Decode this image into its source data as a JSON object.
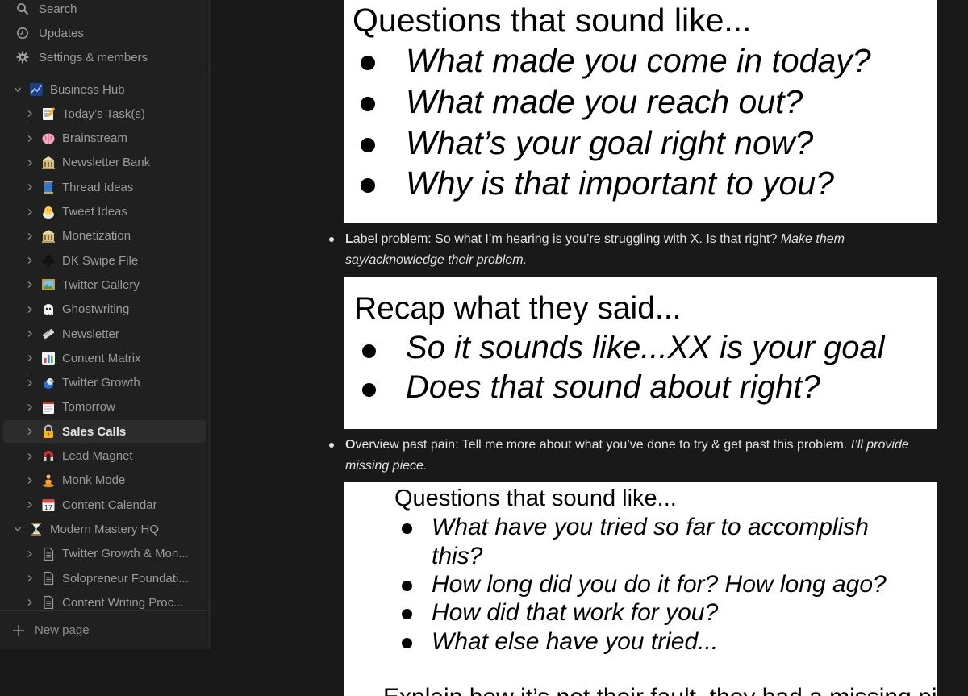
{
  "sidebar": {
    "top": [
      {
        "label": "Search",
        "icon": "search-icon"
      },
      {
        "label": "Updates",
        "icon": "clock-icon"
      },
      {
        "label": "Settings & members",
        "icon": "gear-icon"
      }
    ],
    "tree": [
      {
        "label": "Business Hub",
        "icon": "chart-icon",
        "level": 0,
        "expanded": true
      },
      {
        "label": "Today’s Task(s)",
        "icon": "memo-icon",
        "level": 1
      },
      {
        "label": "Brainstream",
        "icon": "brain-icon",
        "level": 1
      },
      {
        "label": "Newsletter Bank",
        "icon": "bank-icon",
        "level": 1
      },
      {
        "label": "Thread Ideas",
        "icon": "thread-icon",
        "level": 1
      },
      {
        "label": "Tweet Ideas",
        "icon": "chick-icon",
        "level": 1
      },
      {
        "label": "Monetization",
        "icon": "bank-icon",
        "level": 1
      },
      {
        "label": "DK Swipe File",
        "icon": "club-icon",
        "level": 1
      },
      {
        "label": "Twitter Gallery",
        "icon": "picture-icon",
        "level": 1
      },
      {
        "label": "Ghostwriting",
        "icon": "ghost-icon",
        "level": 1
      },
      {
        "label": "Newsletter",
        "icon": "newspaper-icon",
        "level": 1
      },
      {
        "label": "Content Matrix",
        "icon": "bar-chart-icon",
        "level": 1
      },
      {
        "label": "Twitter Growth",
        "icon": "bird-icon",
        "level": 1
      },
      {
        "label": "Tomorrow",
        "icon": "notepad-icon",
        "level": 1
      },
      {
        "label": "Sales Calls",
        "icon": "lock-icon",
        "level": 1,
        "active": true
      },
      {
        "label": "Lead Magnet",
        "icon": "magnet-icon",
        "level": 1
      },
      {
        "label": "Monk Mode",
        "icon": "meditation-icon",
        "level": 1
      },
      {
        "label": "Content Calendar",
        "icon": "calendar-icon",
        "level": 1
      },
      {
        "label": "Modern Mastery HQ",
        "icon": "hourglass-icon",
        "level": 0,
        "expanded": true
      },
      {
        "label": "Twitter Growth & Mon...",
        "icon": "page-icon",
        "level": 1
      },
      {
        "label": "Solopreneur Foundati...",
        "icon": "page-icon",
        "level": 1
      },
      {
        "label": "Content Writing Proc...",
        "icon": "page-icon",
        "level": 1
      }
    ],
    "new_page": "New page"
  },
  "main": {
    "card1": {
      "title": "Questions that sound like...",
      "bullets": [
        "What made you come in today?",
        "What made you reach out?",
        "What’s your goal right now?",
        "Why is that important to you?"
      ]
    },
    "label_line": {
      "lead": "L",
      "text": "abel problem: So what I’m hearing is you’re struggling with X. Is that right? ",
      "italic": "Make them say/acknowledge their problem."
    },
    "card2": {
      "title": "Recap what they said...",
      "bullets": [
        "So it sounds like...XX is your goal",
        "Does that sound about right?"
      ]
    },
    "overview_line": {
      "lead": "O",
      "text": "verview past pain: Tell me more about what you’ve done to try & get past this problem. ",
      "italic": "I’ll provide missing piece."
    },
    "card3": {
      "title": "Questions that sound like...",
      "bullets": [
        "What have you tried so far to accomplish",
        "this?",
        "How long did you do it for? How long ago?",
        "How did that work for you?",
        "What else have you tried..."
      ],
      "footer": "Explain how it’s not their fault, they had a missing piece"
    }
  }
}
